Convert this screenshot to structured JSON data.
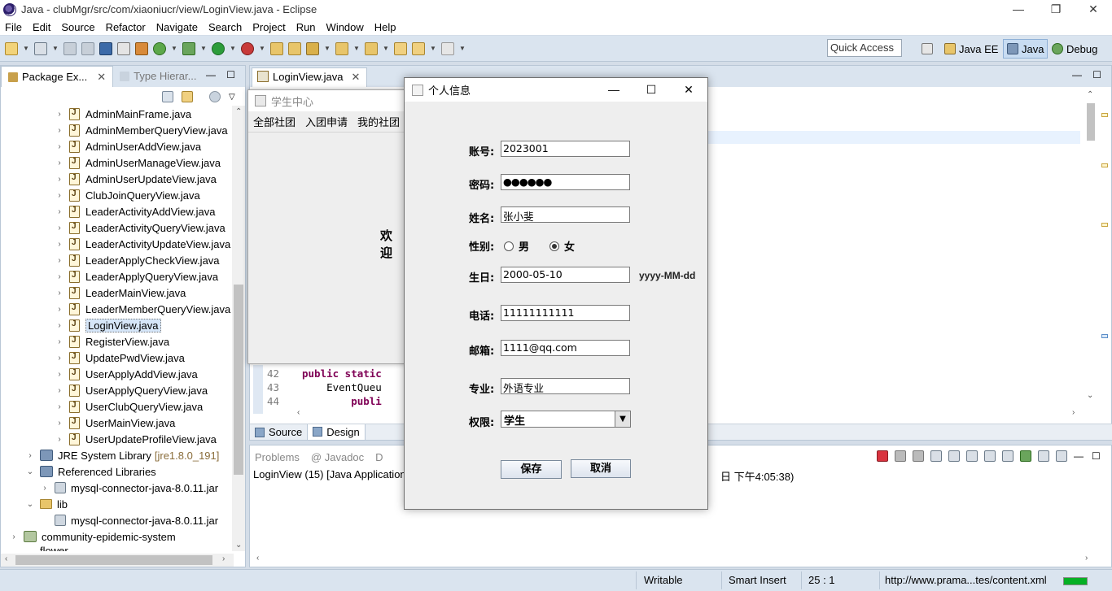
{
  "window": {
    "title": "Java - clubMgr/src/com/xiaoniucr/view/LoginView.java - Eclipse",
    "min": "—",
    "restore": "❐",
    "close": "✕"
  },
  "menu": [
    "File",
    "Edit",
    "Source",
    "Refactor",
    "Navigate",
    "Search",
    "Project",
    "Run",
    "Window",
    "Help"
  ],
  "toolbar": {
    "quick_access": "Quick Access",
    "perspectives": [
      "Java EE",
      "Java",
      "Debug"
    ]
  },
  "left_panel": {
    "tabs": [
      "Package Ex...",
      "Type Hierar..."
    ],
    "files": [
      "AdminMainFrame.java",
      "AdminMemberQueryView.java",
      "AdminUserAddView.java",
      "AdminUserManageView.java",
      "AdminUserUpdateView.java",
      "ClubJoinQueryView.java",
      "LeaderActivityAddView.java",
      "LeaderActivityQueryView.java",
      "LeaderActivityUpdateView.java",
      "LeaderApplyCheckView.java",
      "LeaderApplyQueryView.java",
      "LeaderMainView.java",
      "LeaderMemberQueryView.java",
      "LoginView.java",
      "RegisterView.java",
      "UpdatePwdView.java",
      "UserApplyAddView.java",
      "UserApplyQueryView.java",
      "UserClubQueryView.java",
      "UserMainView.java",
      "UserUpdateProfileView.java"
    ],
    "selected_file": "LoginView.java",
    "jre": {
      "label": "JRE System Library",
      "suffix": "[jre1.8.0_191]"
    },
    "referenced_libraries": "Referenced Libraries",
    "jar1": "mysql-connector-java-8.0.11.jar",
    "lib": "lib",
    "jar2": "mysql-connector-java-8.0.11.jar",
    "project": "community-epidemic-system",
    "project_cut": "flower"
  },
  "editor": {
    "tab": "LoginView.java",
    "code": [
      {
        "ln": "42",
        "kw": "public static",
        "rest": ""
      },
      {
        "ln": "43",
        "kw": "",
        "rest": "    EventQueu"
      },
      {
        "ln": "44",
        "kw": "        publi",
        "rest": ""
      }
    ],
    "bottom_tabs": [
      "Source",
      "Design"
    ]
  },
  "console": {
    "tabs": [
      "Problems",
      "@ Javadoc",
      "D"
    ],
    "line_left": "LoginView (15) [Java Application",
    "line_right": "日 下午4:05:38)"
  },
  "statusbar": {
    "writable": "Writable",
    "insert_mode": "Smart Insert",
    "position": "25 : 1",
    "url": "http://www.prama...tes/content.xml",
    "progress": 1.0
  },
  "student_window": {
    "title": "学生中心",
    "menu": [
      "全部社团",
      "入团申请",
      "我的社团"
    ],
    "welcome": "欢 迎"
  },
  "dialog": {
    "title": "个人信息",
    "account_label": "账号:",
    "account": "2023001",
    "password_label": "密码:",
    "password": "●●●●●●",
    "name_label": "姓名:",
    "name": "张小斐",
    "gender_label": "性别:",
    "gender_male": "男",
    "gender_female": "女",
    "gender_selected": "女",
    "birthday_label": "生日:",
    "birthday": "2000-05-10",
    "birthday_hint": "yyyy-MM-dd",
    "phone_label": "电话:",
    "phone": "11111111111",
    "email_label": "邮箱:",
    "email": "1111@qq.com",
    "major_label": "专业:",
    "major": "外语专业",
    "role_label": "权限:",
    "role": "学生",
    "save": "保存",
    "cancel": "取消"
  }
}
